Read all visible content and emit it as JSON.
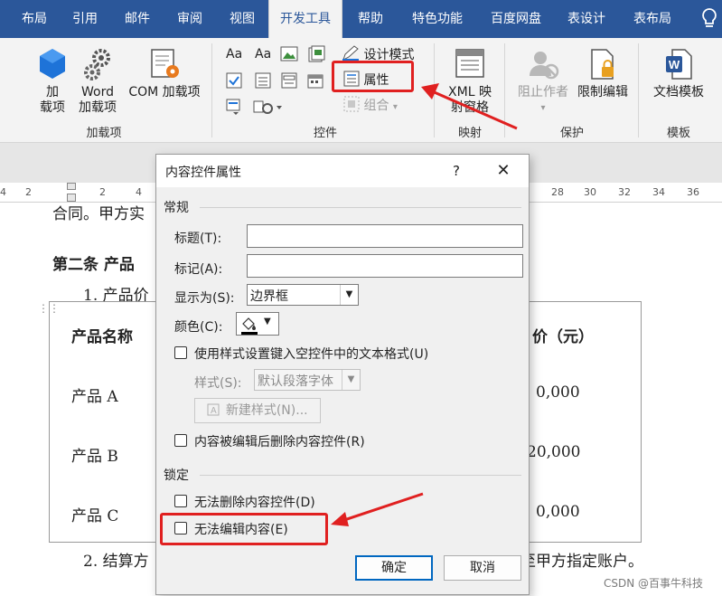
{
  "ribbon": {
    "tabs": [
      "布局",
      "引用",
      "邮件",
      "审阅",
      "视图",
      "开发工具",
      "帮助",
      "特色功能",
      "百度网盘",
      "表设计",
      "表布局"
    ],
    "active_tab": "开发工具",
    "groups": {
      "addins": {
        "label": "加载项",
        "btn_addins": "加\n载项",
        "btn_word_addins": "Word\n加载项",
        "btn_com_addins": "COM 加载项"
      },
      "controls": {
        "label": "控件",
        "design_mode": "设计模式",
        "properties": "属性",
        "group": "组合"
      },
      "mapping": {
        "label": "映射",
        "xml_pane": "XML 映\n射窗格"
      },
      "protect": {
        "label": "保护",
        "block_authors": "阻止作者",
        "restrict_editing": "限制编辑"
      },
      "templates": {
        "label": "模板",
        "doc_template": "文档模板"
      }
    }
  },
  "ruler": {
    "ticks": [
      "4",
      "2",
      "2",
      "4",
      "28",
      "30",
      "32",
      "34",
      "36",
      "38"
    ]
  },
  "document": {
    "line_top": "合同。甲方实",
    "article2": "第二条  产品",
    "item1": "1.  产品价",
    "table_header_name": "产品名称",
    "table_header_price": "价（元）",
    "rows": [
      {
        "name": "产品 A",
        "price": "0,000"
      },
      {
        "name": "产品 B",
        "price": "20,000"
      },
      {
        "name": "产品 C",
        "price": "0,000"
      }
    ],
    "item2_start": "2.  结算方",
    "item2_end": "至甲方指定账户。"
  },
  "dialog": {
    "title": "内容控件属性",
    "help": "?",
    "close": "✕",
    "section_general": "常规",
    "title_label": "标题(T):",
    "title_value": "",
    "tag_label": "标记(A):",
    "tag_value": "",
    "show_as_label": "显示为(S):",
    "show_as_value": "边界框",
    "color_label": "颜色(C):",
    "use_style_label": "使用样式设置键入空控件中的文本格式(U)",
    "style_label": "样式(S):",
    "style_value": "默认段落字体",
    "new_style_btn": "新建样式(N)...",
    "remove_label": "内容被编辑后删除内容控件(R)",
    "section_lock": "锁定",
    "lock_delete_label": "无法删除内容控件(D)",
    "lock_edit_label": "无法编辑内容(E)",
    "ok": "确定",
    "cancel": "取消"
  },
  "watermark": "CSDN @百事牛科技",
  "colors": {
    "ribbon_blue": "#2b579a",
    "annotation_red": "#e02020",
    "default_button_border": "#0067c0"
  }
}
